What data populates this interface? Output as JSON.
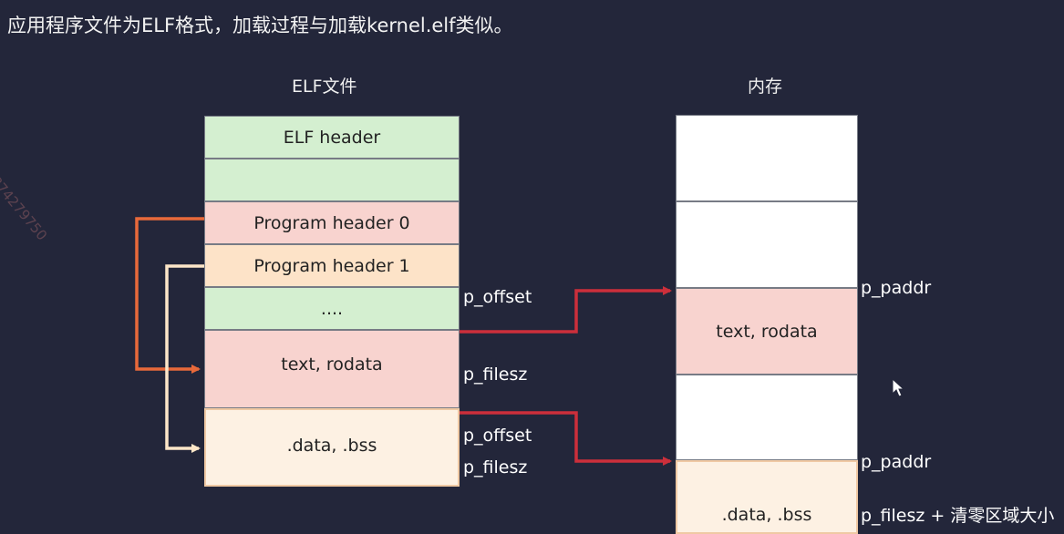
{
  "title": "应用程序文件为ELF格式，加载过程与加载kernel.elf类似。",
  "watermark": "874279750",
  "elf": {
    "title": "ELF文件",
    "blocks": [
      {
        "label": "ELF header",
        "color": "#d4efd0"
      },
      {
        "label": "",
        "color": "#d4efd0"
      },
      {
        "label": "Program header 0",
        "color": "#f8d3cf"
      },
      {
        "label": "Program header 1",
        "color": "#fde3c8"
      },
      {
        "label": "....",
        "color": "#d4efd0"
      },
      {
        "label": "text, rodata",
        "color": "#f8d3cf"
      },
      {
        "label": ".data, .bss",
        "color": "#fdf1e3"
      }
    ],
    "labels": {
      "offset1": "p_offset",
      "filesz1": "p_filesz",
      "offset2": "p_offset",
      "filesz2": "p_filesz"
    }
  },
  "memory": {
    "title": "内存",
    "blocks": [
      {
        "label": "",
        "color": "#ffffff"
      },
      {
        "label": "",
        "color": "#ffffff"
      },
      {
        "label": "text, rodata",
        "color": "#f8d3cf"
      },
      {
        "label": "",
        "color": "#ffffff"
      },
      {
        "label": ".data, .bss",
        "color": "#fdf1e3"
      }
    ],
    "labels": {
      "paddr1": "p_paddr",
      "paddr2": "p_paddr",
      "filesz_bss": "p_filesz + 清零区域大小"
    }
  },
  "colors": {
    "arrow_red": "#cc2f3b",
    "arrow_orange": "#e8693a",
    "arrow_cream": "#fde6c8"
  }
}
